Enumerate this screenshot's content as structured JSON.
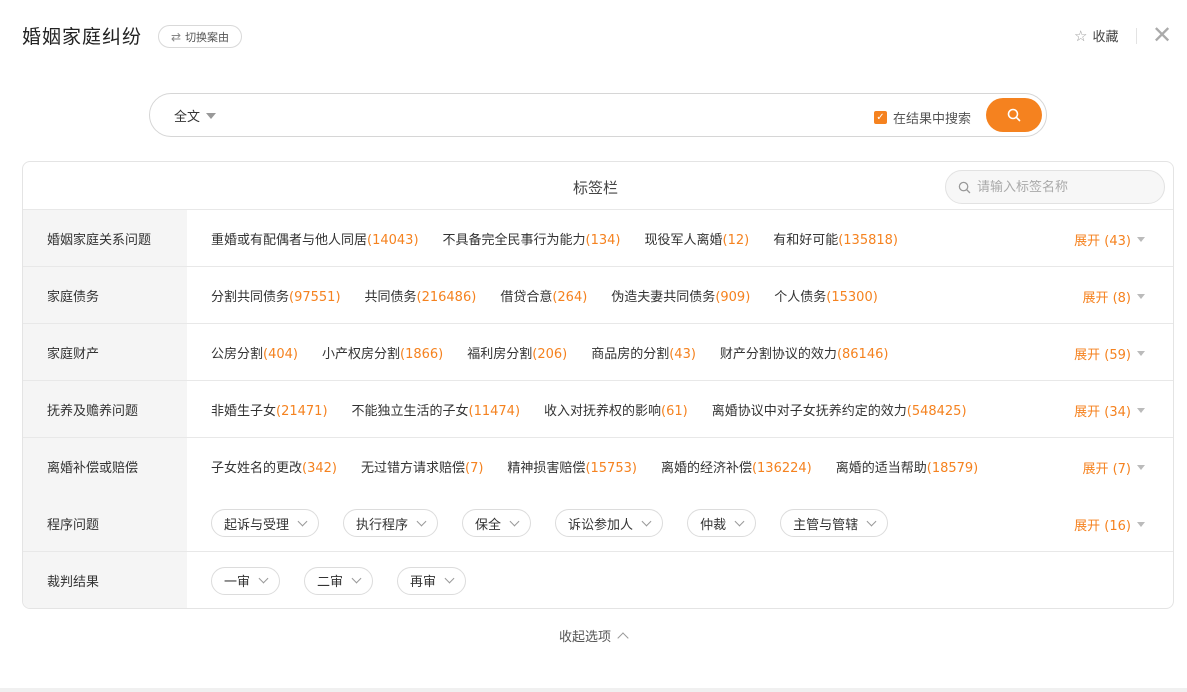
{
  "header": {
    "title": "婚姻家庭纠纷",
    "switch_label": "切换案由",
    "favorite_label": "收藏"
  },
  "search": {
    "scope": "全文",
    "value": "",
    "in_results_label": "在结果中搜索",
    "in_results_checked": true
  },
  "panel": {
    "title": "标签栏",
    "tag_search_placeholder": "请输入标签名称",
    "rows": [
      {
        "label": "婚姻家庭关系问题",
        "tags": [
          {
            "name": "重婚或有配偶者与他人同居",
            "count": "(14043)"
          },
          {
            "name": "不具备完全民事行为能力",
            "count": "(134)"
          },
          {
            "name": "现役军人离婚",
            "count": "(12)"
          },
          {
            "name": "有和好可能",
            "count": "(135818)"
          }
        ],
        "expand": "展开 (43)"
      },
      {
        "label": "家庭债务",
        "tags": [
          {
            "name": "分割共同债务",
            "count": "(97551)"
          },
          {
            "name": "共同债务",
            "count": "(216486)"
          },
          {
            "name": "借贷合意",
            "count": "(264)"
          },
          {
            "name": "伪造夫妻共同债务",
            "count": "(909)"
          },
          {
            "name": "个人债务",
            "count": "(15300)"
          }
        ],
        "expand": "展开 (8)"
      },
      {
        "label": "家庭财产",
        "tags": [
          {
            "name": "公房分割",
            "count": "(404)"
          },
          {
            "name": "小产权房分割",
            "count": "(1866)"
          },
          {
            "name": "福利房分割",
            "count": "(206)"
          },
          {
            "name": "商品房的分割",
            "count": "(43)"
          },
          {
            "name": "财产分割协议的效力",
            "count": "(86146)"
          }
        ],
        "expand": "展开 (59)"
      },
      {
        "label": "抚养及赡养问题",
        "tags": [
          {
            "name": "非婚生子女",
            "count": "(21471)"
          },
          {
            "name": "不能独立生活的子女",
            "count": "(11474)"
          },
          {
            "name": "收入对抚养权的影响",
            "count": "(61)"
          },
          {
            "name": "离婚协议中对子女抚养约定的效力",
            "count": "(548425)"
          }
        ],
        "expand": "展开 (34)"
      },
      {
        "label": "离婚补偿或赔偿",
        "tags": [
          {
            "name": "子女姓名的更改",
            "count": "(342)"
          },
          {
            "name": "无过错方请求赔偿",
            "count": "(7)"
          },
          {
            "name": "精神损害赔偿",
            "count": "(15753)"
          },
          {
            "name": "离婚的经济补偿",
            "count": "(136224)"
          },
          {
            "name": "离婚的适当帮助",
            "count": "(18579)"
          }
        ],
        "expand": "展开 (7)"
      }
    ],
    "procedure": {
      "label": "程序问题",
      "pills": [
        "起诉与受理",
        "执行程序",
        "保全",
        "诉讼参加人",
        "仲裁",
        "主管与管辖"
      ],
      "expand": "展开 (16)"
    },
    "result": {
      "label": "裁判结果",
      "pills": [
        "一审",
        "二审",
        "再审"
      ]
    }
  },
  "collapse_label": "收起选项",
  "colors": {
    "accent": "#f5821f",
    "label_bg": "#f5f5f5",
    "border": "#e4e4e4"
  }
}
